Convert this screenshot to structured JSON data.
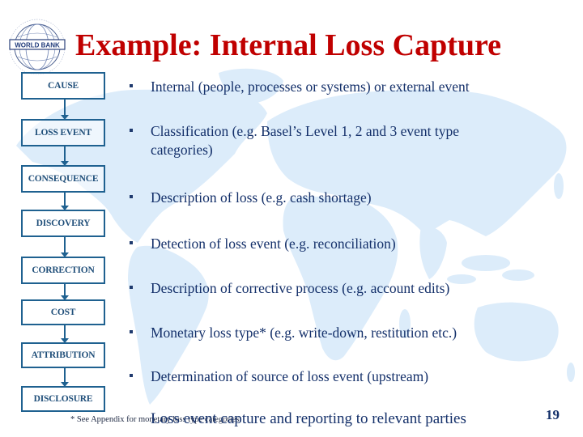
{
  "slide": {
    "title": "Example: Internal Loss Capture",
    "logo_text": "WORLD BANK",
    "page_number": "19"
  },
  "flow": [
    "CAUSE",
    "LOSS EVENT",
    "CONSEQUENCE",
    "DISCOVERY",
    "CORRECTION",
    "COST",
    "ATTRIBUTION",
    "DISCLOSURE"
  ],
  "bullets": [
    "Internal (people, processes or systems) or external event",
    "Classification (e.g. Basel’s Level 1, 2 and 3 event type categories)",
    "Description of loss (e.g. cash shortage)",
    "Detection of loss event (e.g. reconciliation)",
    "Description of corrective process (e.g. account edits)",
    "Monetary loss type* (e.g. write-down, restitution etc.)",
    "Determination of source of loss event (upstream)"
  ],
  "last_line": "Loss event capture and reporting to relevant parties",
  "footnote": "* See Appendix for monetary loss type categories",
  "colors": {
    "title": "#c00000",
    "box_border": "#1f6190",
    "box_text": "#1f4e79",
    "body_text": "#14306a",
    "map": "#dcecfa"
  }
}
